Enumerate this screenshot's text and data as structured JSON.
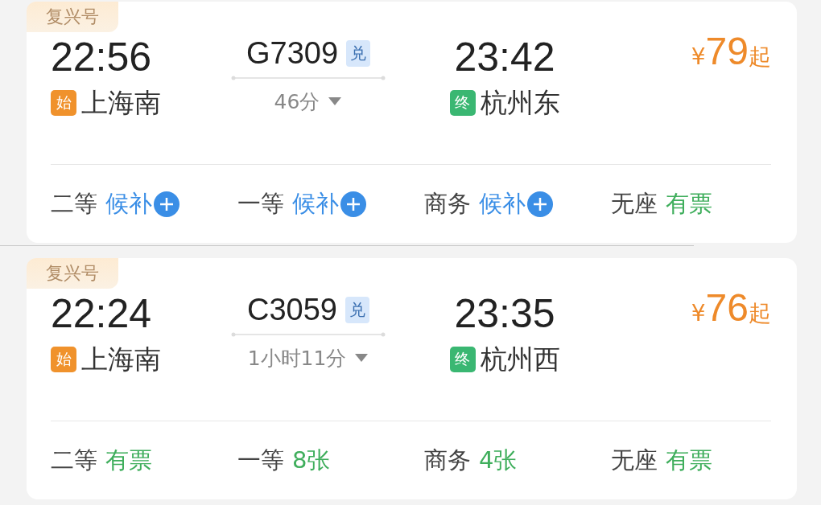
{
  "trains": [
    {
      "tag": "复兴号",
      "depart": {
        "time": "22:56",
        "badge": "始",
        "station": "上海南"
      },
      "train_no": "G7309",
      "exchange_badge": "兑",
      "duration": "46分",
      "arrive": {
        "time": "23:42",
        "badge": "终",
        "station": "杭州东"
      },
      "price": {
        "currency": "¥",
        "amount": "79",
        "suffix": "起"
      },
      "seats": [
        {
          "class": "二等",
          "status": "候补",
          "kind": "waitlist"
        },
        {
          "class": "一等",
          "status": "候补",
          "kind": "waitlist"
        },
        {
          "class": "商务",
          "status": "候补",
          "kind": "waitlist"
        },
        {
          "class": "无座",
          "status": "有票",
          "kind": "available"
        }
      ]
    },
    {
      "tag": "复兴号",
      "depart": {
        "time": "22:24",
        "badge": "始",
        "station": "上海南"
      },
      "train_no": "C3059",
      "exchange_badge": "兑",
      "duration": "1小时11分",
      "arrive": {
        "time": "23:35",
        "badge": "终",
        "station": "杭州西"
      },
      "price": {
        "currency": "¥",
        "amount": "76",
        "suffix": "起"
      },
      "seats": [
        {
          "class": "二等",
          "status": "有票",
          "kind": "available"
        },
        {
          "class": "一等",
          "status": "8张",
          "kind": "available"
        },
        {
          "class": "商务",
          "status": "4张",
          "kind": "available"
        },
        {
          "class": "无座",
          "status": "有票",
          "kind": "available"
        }
      ]
    }
  ]
}
